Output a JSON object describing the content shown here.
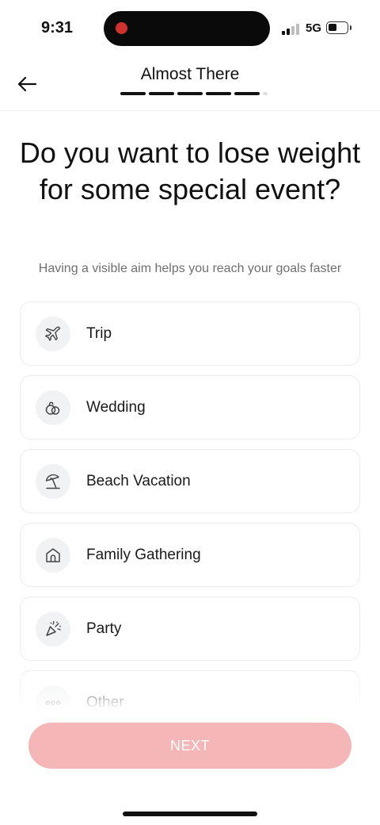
{
  "status_bar": {
    "time": "9:31",
    "network": "5G",
    "recording_color": "#d0312d"
  },
  "header": {
    "title": "Almost There",
    "back_icon": "arrow-left-icon",
    "progress": {
      "completed_steps": 5,
      "total_steps": 6
    }
  },
  "question": {
    "title": "Do you want to lose weight for some special event?",
    "subtitle": "Having a visible aim helps you reach your goals faster"
  },
  "options": [
    {
      "label": "Trip",
      "icon": "airplane-icon"
    },
    {
      "label": "Wedding",
      "icon": "rings-icon"
    },
    {
      "label": "Beach Vacation",
      "icon": "beach-umbrella-icon"
    },
    {
      "label": "Family Gathering",
      "icon": "house-icon"
    },
    {
      "label": "Party",
      "icon": "party-popper-icon"
    },
    {
      "label": "Other",
      "icon": "more-dots-icon"
    }
  ],
  "next_button": {
    "label": "NEXT",
    "color": "#f5b6b8"
  }
}
